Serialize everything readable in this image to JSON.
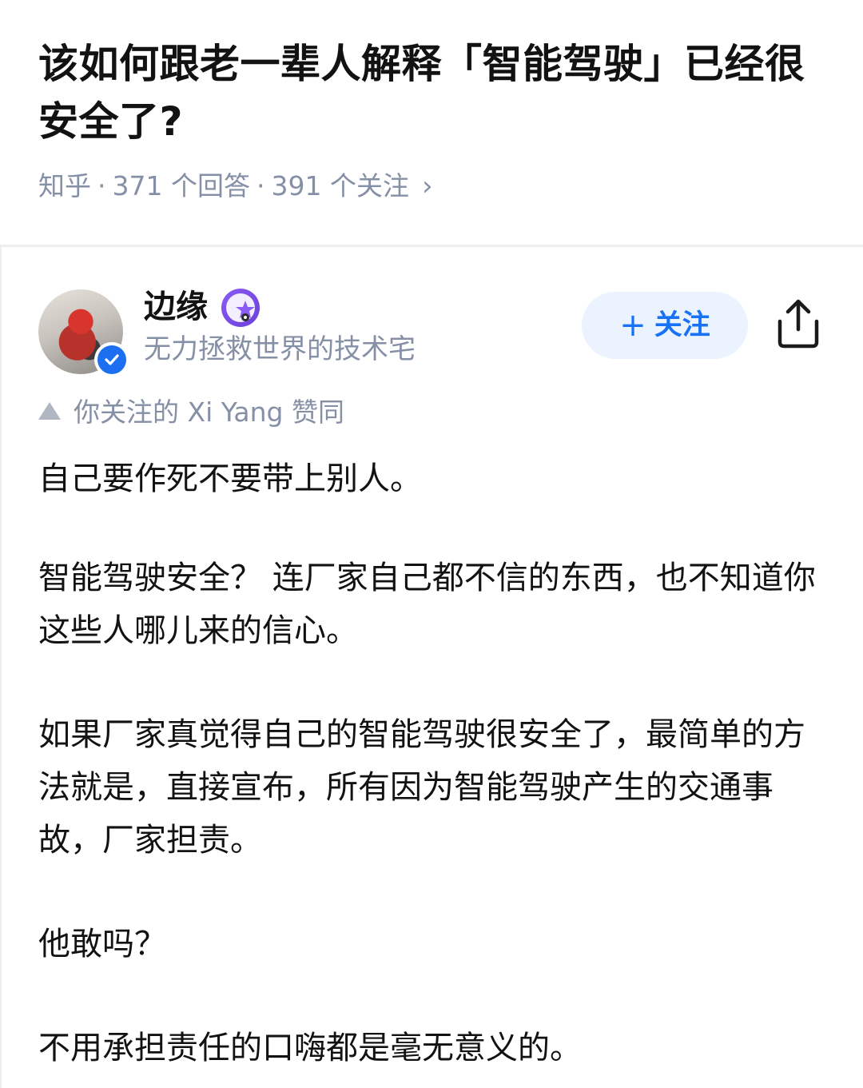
{
  "question": {
    "title": "该如何跟老一辈人解释「智能驾驶」已经很安全了?",
    "source": "知乎",
    "separator": "·",
    "answers_count": "371 个回答",
    "followers_count": "391 个关注",
    "chevron": "›"
  },
  "author": {
    "name": "边缘",
    "bio": "无力拯救世界的技术宅",
    "verified_icon": "verified-check-icon",
    "badge_icon": "creator-badge-icon",
    "follow_label": "关注",
    "follow_plus": "+",
    "share_icon": "share-icon"
  },
  "endorsement": {
    "icon": "upvote-triangle-icon",
    "text": "你关注的 Xi Yang 赞同"
  },
  "content": {
    "paragraphs": [
      "自己要作死不要带上别人。",
      "智能驾驶安全？ 连厂家自己都不信的东西，也不知道你这些人哪儿来的信心。",
      "如果厂家真觉得自己的智能驾驶很安全了，最简单的方法就是，直接宣布，所有因为智能驾驶产生的交通事故，厂家担责。",
      "他敢吗？",
      "不用承担责任的口嗨都是毫无意义的。"
    ]
  },
  "colors": {
    "accent": "#1772f6",
    "follow_bg": "#ebf3ff",
    "meta_gray": "#8590a6",
    "text": "#121212",
    "verified_blue": "#1d6ff2",
    "badge_purple": "#7c4dee"
  }
}
